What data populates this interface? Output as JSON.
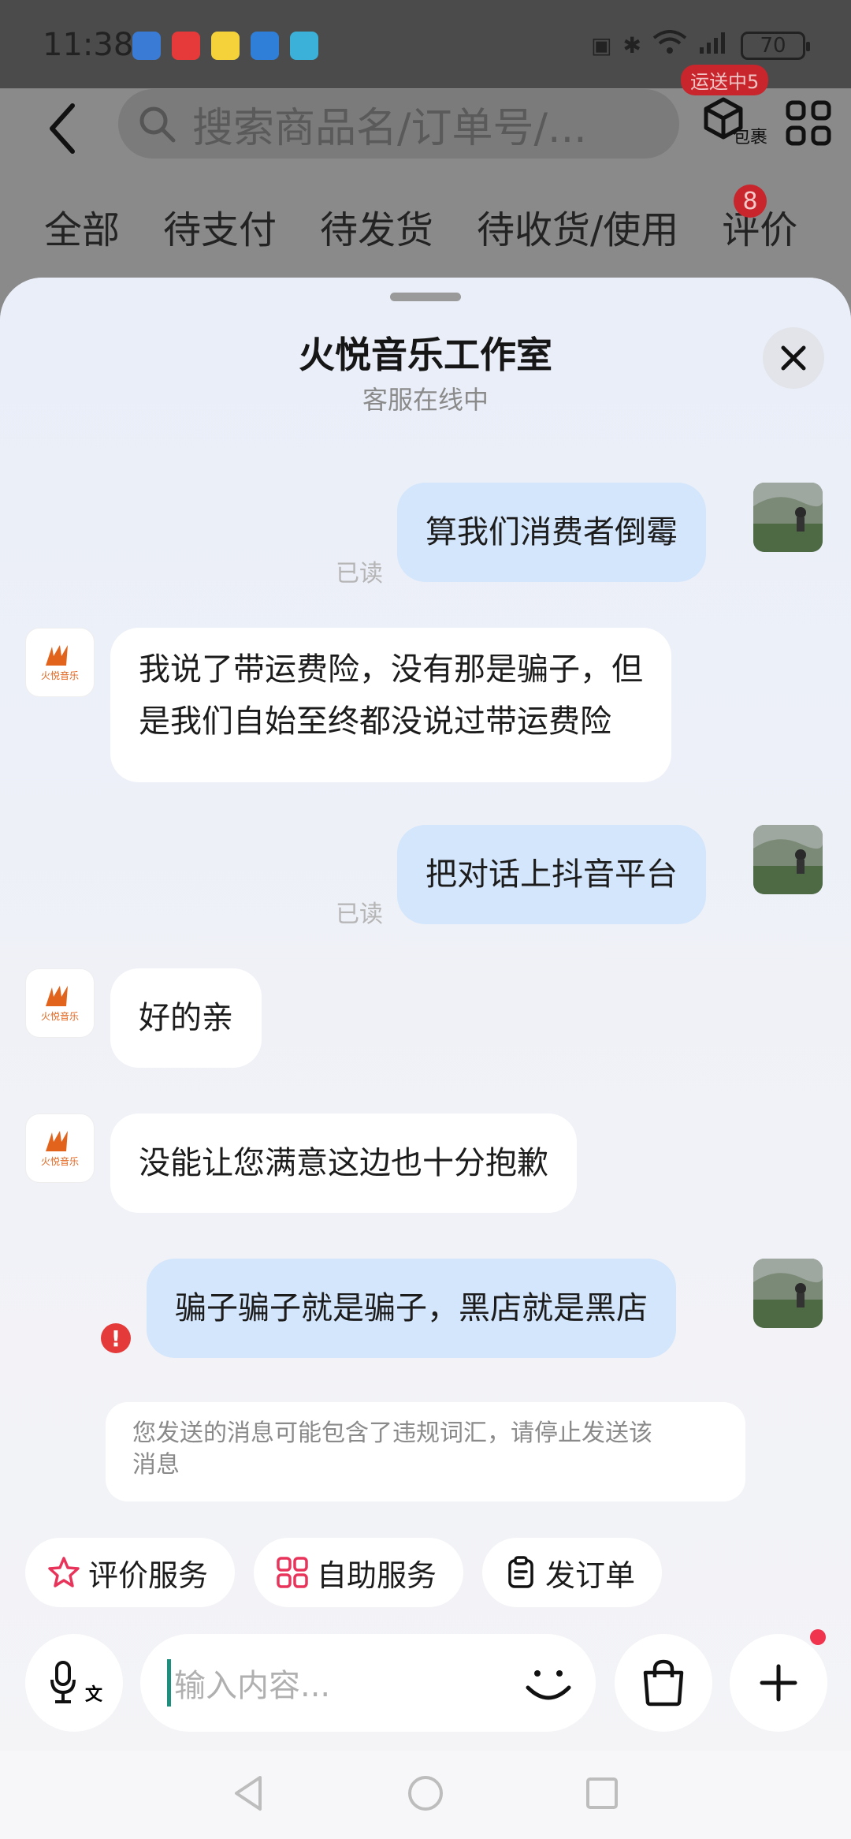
{
  "status_bar": {
    "time": "11:38",
    "battery": "70",
    "signal": "6"
  },
  "order_page": {
    "search_placeholder": "搜索商品名/订单号/...",
    "package_label": "包裹",
    "shipping_badge": "运送中5",
    "tabs": [
      "全部",
      "待支付",
      "待发货",
      "待收货/使用",
      "评价"
    ],
    "tab_badge": "8"
  },
  "chat": {
    "title": "火悦音乐工作室",
    "subtitle": "客服在线中",
    "read_label": "已读",
    "shop_avatar_text": "火悦音乐",
    "messages": [
      {
        "from": "me",
        "text": "算我们消费者倒霉"
      },
      {
        "from": "them",
        "line1": "我说了带运费险，没有那是骗子，但",
        "line2": "是我们自始至终都没说过带运费险"
      },
      {
        "from": "me",
        "text": "把对话上抖音平台"
      },
      {
        "from": "them",
        "text": "好的亲"
      },
      {
        "from": "them",
        "text": "没能让您满意这边也十分抱歉"
      },
      {
        "from": "me",
        "text": "骗子骗子就是骗子，黑店就是黑店"
      }
    ],
    "warning_line1": "您发送的消息可能包含了违规词汇，请停止发送该",
    "warning_line2": "消息",
    "error_mark": "!"
  },
  "quick_actions": [
    {
      "label": "评价服务",
      "icon": "star-icon"
    },
    {
      "label": "自助服务",
      "icon": "grid-icon"
    },
    {
      "label": "发订单",
      "icon": "clipboard-icon"
    }
  ],
  "input": {
    "placeholder": "输入内容...",
    "voice_sub_label": "文"
  },
  "colors": {
    "my_bubble": "#d4e6fb",
    "their_bubble": "#ffffff",
    "error": "#e43a3a",
    "badge": "#c8262c"
  }
}
